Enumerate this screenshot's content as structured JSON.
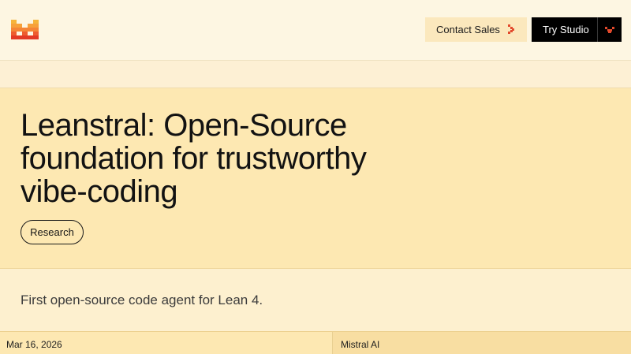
{
  "header": {
    "logo_icon": "mistral-pixel-logo-icon",
    "contact_label": "Contact Sales",
    "try_label": "Try Studio",
    "accent": "#e2492c"
  },
  "hero": {
    "title": "Leanstral: Open-Source foundation for trustworthy vibe-coding",
    "tag": "Research",
    "background": "#fde8b2"
  },
  "summary": {
    "text": "First open-source code agent for Lean 4."
  },
  "meta": {
    "date": "Mar 16, 2026",
    "author": "Mistral AI"
  }
}
